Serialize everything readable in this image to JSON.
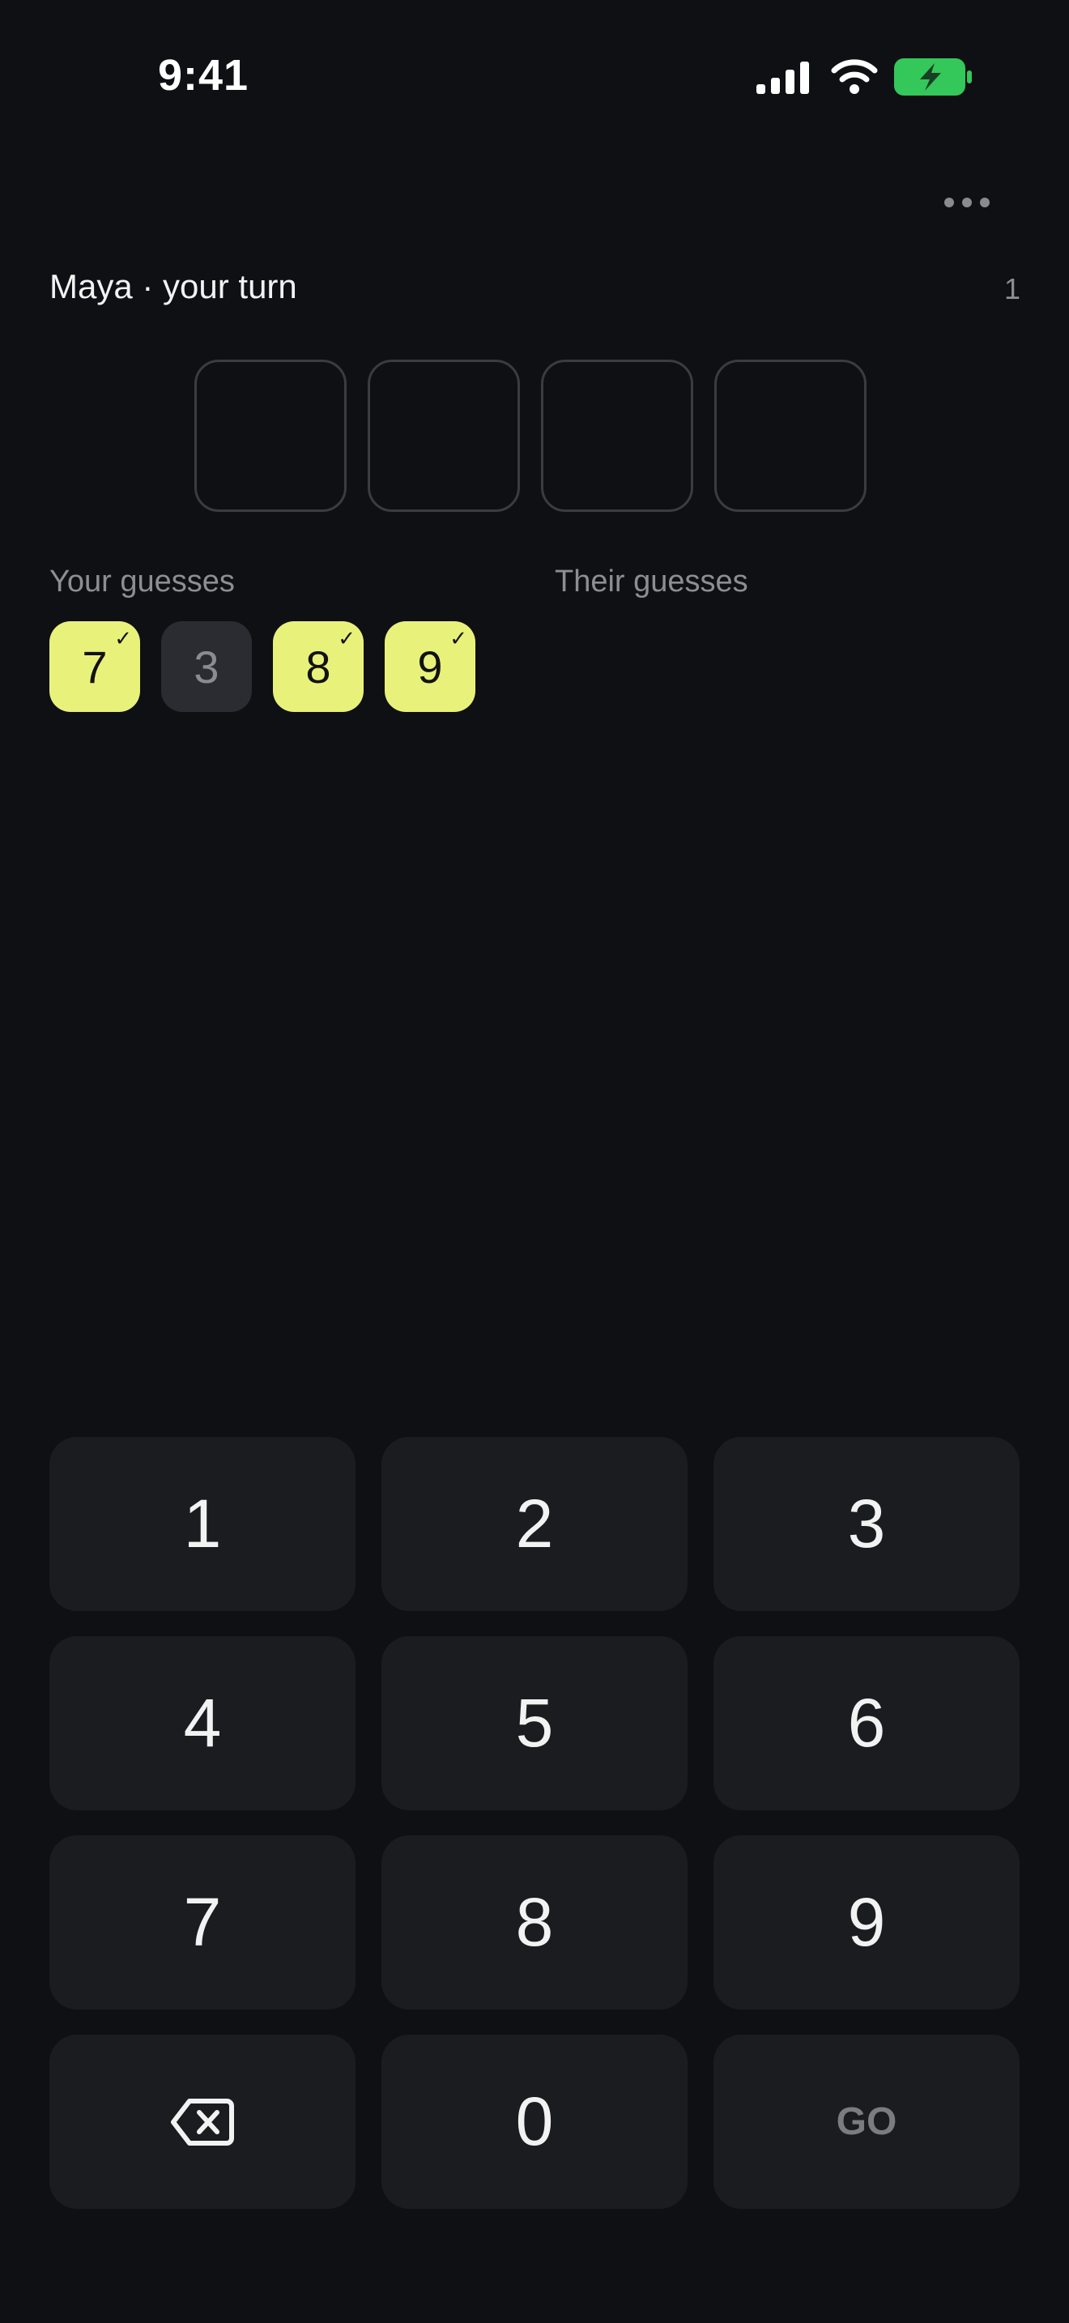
{
  "status_bar": {
    "time": "9:41"
  },
  "header": {
    "turn_label": "Maya · your turn",
    "round_number": "1"
  },
  "slots": [
    "",
    "",
    "",
    ""
  ],
  "guesses": {
    "your_label": "Your guesses",
    "their_label": "Their guesses",
    "your": [
      {
        "digit": "7",
        "state": "hit",
        "mark": "✓"
      },
      {
        "digit": "3",
        "state": "miss",
        "mark": ""
      },
      {
        "digit": "8",
        "state": "hit",
        "mark": "✓"
      },
      {
        "digit": "9",
        "state": "hit",
        "mark": "✓"
      }
    ],
    "their": []
  },
  "keypad": {
    "keys": [
      "1",
      "2",
      "3",
      "4",
      "5",
      "6",
      "7",
      "8",
      "9"
    ],
    "zero": "0",
    "go": "GO",
    "backspace_icon": "backspace-icon"
  },
  "colors": {
    "background": "#0f1014",
    "key": "#1b1c20",
    "hit": "#e8f27a",
    "miss": "#2b2c31",
    "battery": "#34c759"
  }
}
